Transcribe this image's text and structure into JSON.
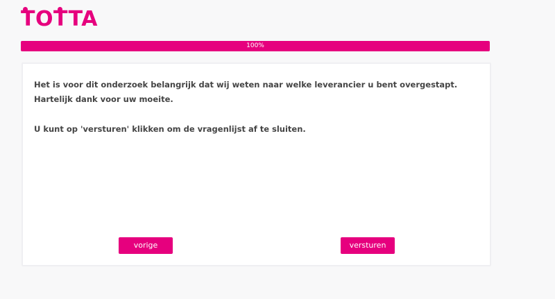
{
  "brand": {
    "logo_text": "TOTTA",
    "accent_color": "#e6007e"
  },
  "progress": {
    "label": "100%",
    "value": 1.0
  },
  "content": {
    "line1": "Het is voor dit onderzoek belangrijk dat wij weten naar welke leverancier u bent overgestapt.",
    "line2": "Hartelijk dank voor uw moeite.",
    "line3": "U kunt op 'versturen' klikken om de vragenlijst af te sluiten."
  },
  "buttons": {
    "prev_label": "vorige",
    "next_label": "versturen"
  }
}
